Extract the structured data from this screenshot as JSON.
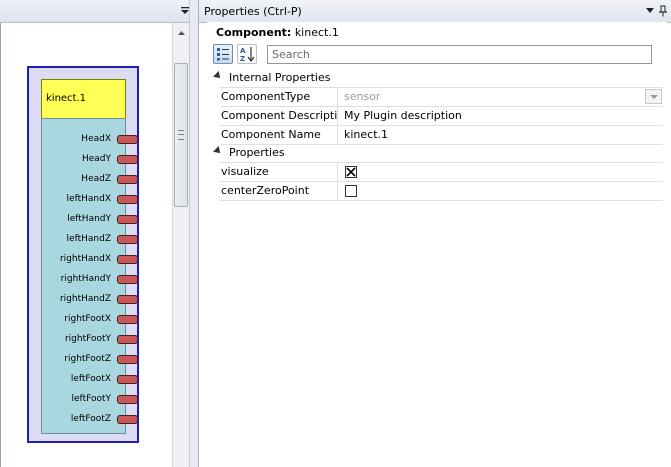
{
  "properties_panel": {
    "title": "Properties (Ctrl-P)",
    "component_prefix": "Component:",
    "component_name": "kinect.1",
    "search_placeholder": "Search",
    "categories": [
      {
        "label": "Internal Properties",
        "rows": [
          {
            "name": "ComponentType",
            "value": "sensor"
          },
          {
            "name": "Component Description",
            "value": "My Plugin description"
          },
          {
            "name": "Component Name",
            "value": "kinect.1"
          }
        ]
      },
      {
        "label": "Properties",
        "rows": [
          {
            "name": "visualize",
            "checked": true
          },
          {
            "name": "centerZeroPoint",
            "checked": false
          }
        ]
      }
    ]
  },
  "canvas": {
    "component": {
      "title": "kinect.1",
      "ports": [
        "HeadX",
        "HeadY",
        "HeadZ",
        "leftHandX",
        "leftHandY",
        "leftHandZ",
        "rightHandX",
        "rightHandY",
        "rightHandZ",
        "rightFootX",
        "rightFootY",
        "rightFootZ",
        "leftFootX",
        "leftFootY",
        "leftFootZ"
      ]
    }
  },
  "colors": {
    "title_bar": "#ffff55",
    "block_body": "#a9d7df",
    "block_border": "#1d1fb0",
    "port": "#c65a5a"
  },
  "icons": {
    "left_menu": "chevron-down-menu-icon",
    "props_menu": "dropdown-arrow-icon",
    "pin": "pin-icon",
    "categorized": "categorized-view-icon",
    "alphabetical": "sort-az-icon"
  }
}
